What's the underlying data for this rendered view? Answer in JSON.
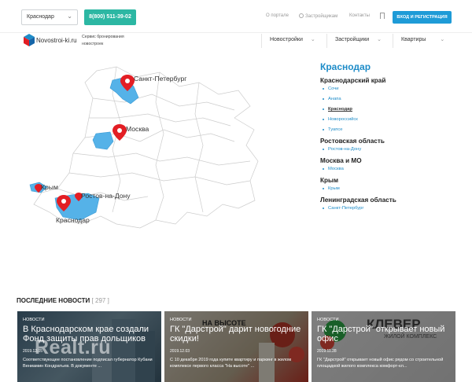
{
  "topbar": {
    "city": "Краснодар",
    "phone": "8(800) 511-39-02",
    "links": [
      "О портале",
      "Застройщикам",
      "Контакты"
    ],
    "login": "ВХОД И РЕГИСТРАЦИЯ"
  },
  "header": {
    "logo": "Novostroi-ki.ru",
    "slogan": "Сервис бронирования новостроек",
    "nav": [
      "Новостройки",
      "Застройщики",
      "Квартиры"
    ]
  },
  "map": {
    "labels": [
      "Санкт-Петербург",
      "Москва",
      "Крым",
      "Ростов-на-Дону",
      "Краснодар"
    ]
  },
  "regions": {
    "title": "Краснодар",
    "groups": [
      {
        "name": "Краснодарский край",
        "cities": [
          "Сочи",
          "Анапа",
          "Краснодар",
          "Новороссийск",
          "Туапсе"
        ]
      },
      {
        "name": "Ростовская область",
        "cities": [
          "Ростов-на-Дону"
        ]
      },
      {
        "name": "Москва и МО",
        "cities": [
          "Москва"
        ]
      },
      {
        "name": "Крым",
        "cities": [
          "Крым"
        ]
      },
      {
        "name": "Ленинградская область",
        "cities": [
          "Санкт-Петербург"
        ]
      }
    ]
  },
  "news": {
    "title": "ПОСЛЕДНИЕ НОВОСТИ",
    "count": "[ 297 ]",
    "watermark": "Realt.ru",
    "cards": [
      {
        "category": "НОВОСТИ",
        "title": "В Краснодарском крае создали Фонд защиты прав дольщиков",
        "date": "2019.12.05",
        "text": "Соответствующее постановление подписал губернатор Кубани Вениамин Кондратьев. В документе ..."
      },
      {
        "category": "НОВОСТИ",
        "title": "ГК \"Дарстрой\" дарит новогодние скидки!",
        "date": "2019.12.03",
        "text": "С 10 декабря 2019 года купите квартиру и паркинг в жилом комплексе первого класса \"На высоте\" ..."
      },
      {
        "category": "НОВОСТИ",
        "title": "ГК \"Дарстрой\" открывает новый офис",
        "date": "2019.11.28",
        "text": "ГК \"Дарстрой\" открывает новый офис рядом со строительной площадкой жилого комплекса комфорт-кл..."
      }
    ],
    "card_images": [
      "НА ВЫСОТЕ",
      "КЛЕВЕР",
      "ЖИЛОЙ КОМПЛЕКС"
    ]
  },
  "colors": {
    "accent": "#1e8cc8",
    "phone_btn": "#2cb7a3",
    "login_btn": "#1e9bd7",
    "map_region": "#55b2e8",
    "pin": "#e31e24"
  }
}
